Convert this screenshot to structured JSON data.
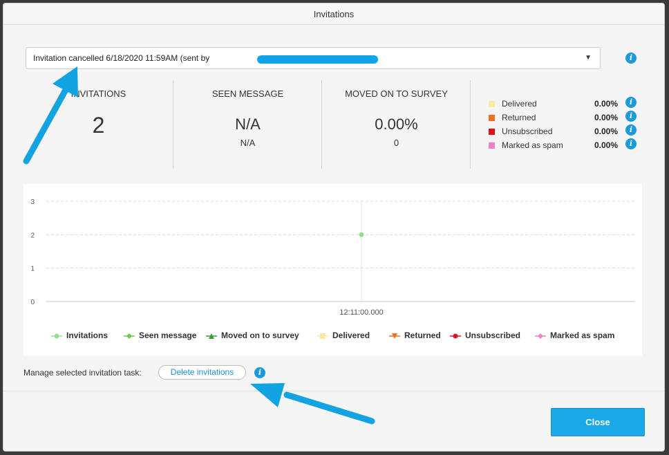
{
  "dialog": {
    "title": "Invitations"
  },
  "task_select": {
    "value": "Invitation cancelled 6/18/2020 11:59AM (sent by"
  },
  "stats": [
    {
      "label": "INVITATIONS",
      "big": "2",
      "small": ""
    },
    {
      "label": "SEEN MESSAGE",
      "big": "N/A",
      "small": "N/A"
    },
    {
      "label": "MOVED ON TO SURVEY",
      "big": "0.00%",
      "small": "0"
    }
  ],
  "status_stats": [
    {
      "name": "Delivered",
      "value": "0.00%",
      "color": "#fbe9a8"
    },
    {
      "name": "Returned",
      "value": "0.00%",
      "color": "#f07020"
    },
    {
      "name": "Unsubscribed",
      "value": "0.00%",
      "color": "#e01020"
    },
    {
      "name": "Marked as spam",
      "value": "0.00%",
      "color": "#f080c8"
    }
  ],
  "chart_data": {
    "type": "line",
    "x": [
      "12:11:00.000"
    ],
    "ylim": [
      0,
      3
    ],
    "yticks": [
      "0",
      "1",
      "2",
      "3"
    ],
    "grid": true,
    "legend": "bottom",
    "series": [
      {
        "name": "Invitations",
        "values": [
          2
        ],
        "color": "#8fe08f",
        "marker": "circle"
      },
      {
        "name": "Seen message",
        "values": [],
        "color": "#66cc44",
        "marker": "diamond"
      },
      {
        "name": "Moved on to survey",
        "values": [],
        "color": "#33a033",
        "marker": "triangle"
      },
      {
        "name": "Delivered",
        "values": [],
        "color": "#fbe9a8",
        "marker": "square"
      },
      {
        "name": "Returned",
        "values": [],
        "color": "#f07020",
        "marker": "triangle-down"
      },
      {
        "name": "Unsubscribed",
        "values": [],
        "color": "#e01020",
        "marker": "circle"
      },
      {
        "name": "Marked as spam",
        "values": [],
        "color": "#f080c8",
        "marker": "diamond"
      }
    ]
  },
  "manage": {
    "label": "Manage selected invitation task:",
    "delete_label": "Delete invitations"
  },
  "footer": {
    "close_label": "Close"
  },
  "icons": {
    "info": "i"
  }
}
